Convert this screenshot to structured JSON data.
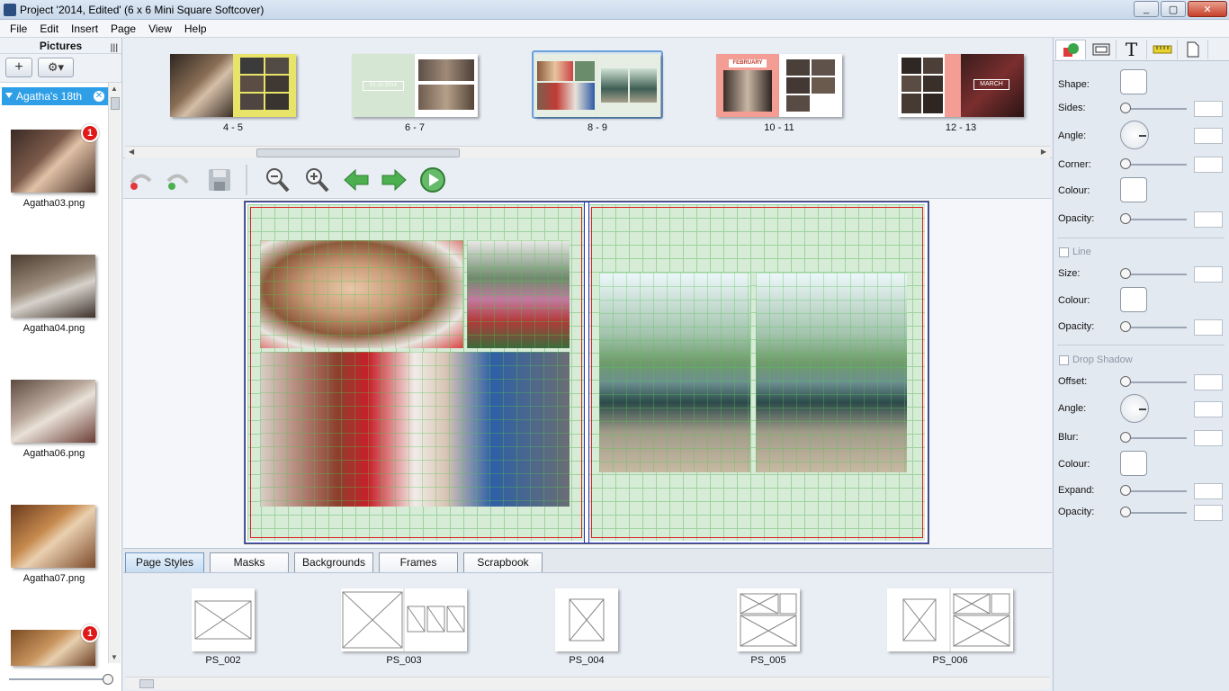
{
  "window": {
    "title": "Project '2014, Edited' (6 x 6 Mini Square Softcover)",
    "minimize": "_",
    "maximize": "▢",
    "close": "✕"
  },
  "menu": [
    "File",
    "Edit",
    "Insert",
    "Page",
    "View",
    "Help"
  ],
  "pictures_panel": {
    "header": "Pictures",
    "add_button": "+",
    "settings_button": "⚙▾",
    "album_tab": "Agatha's 18th",
    "album_close": "✕",
    "items": [
      {
        "name": "Agatha03.png",
        "badge": "1"
      },
      {
        "name": "Agatha04.png",
        "badge": ""
      },
      {
        "name": "Agatha06.png",
        "badge": ""
      },
      {
        "name": "Agatha07.png",
        "badge": ""
      },
      {
        "name": "",
        "badge": "1"
      }
    ]
  },
  "page_strip": {
    "spreads": [
      {
        "label": "4 - 5"
      },
      {
        "label": "6 - 7",
        "caption": "01.20.2014"
      },
      {
        "label": "8 - 9",
        "selected": true
      },
      {
        "label": "10 - 11",
        "caption": "FEBRUARY"
      },
      {
        "label": "12 - 13",
        "caption": "MARCH"
      }
    ]
  },
  "editor_toolbar": {
    "icons": [
      "undo-icon",
      "redo-icon",
      "save-icon",
      "zoom-out-icon",
      "zoom-in-icon",
      "previous-icon",
      "next-icon",
      "play-icon"
    ]
  },
  "bottom_tabs": [
    "Page Styles",
    "Masks",
    "Backgrounds",
    "Frames",
    "Scrapbook"
  ],
  "page_styles": [
    "PS_002",
    "PS_003",
    "PS_004",
    "PS_005",
    "PS_006"
  ],
  "properties": {
    "shape": "Shape:",
    "sides": "Sides:",
    "angle": "Angle:",
    "corner": "Corner:",
    "colour": "Colour:",
    "opacity": "Opacity:",
    "line_section": "Line",
    "size": "Size:",
    "drop_shadow_section": "Drop Shadow",
    "offset": "Offset:",
    "blur": "Blur:",
    "expand": "Expand:"
  },
  "colors": {
    "accent": "#2e9fe6",
    "badge": "#e01818",
    "grid": "#9ed29e"
  }
}
